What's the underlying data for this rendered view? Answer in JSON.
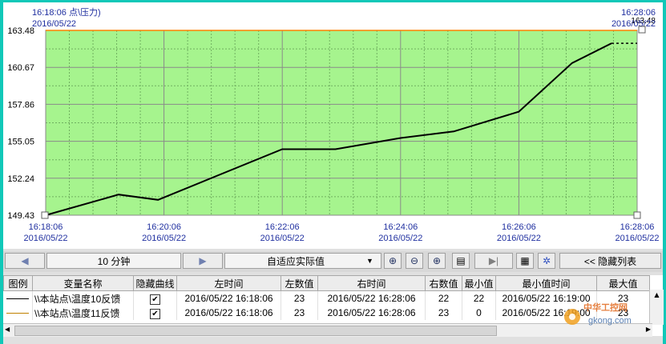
{
  "chart": {
    "top_left_time": "16:18:06",
    "top_left_title": "点\\压力)",
    "top_left_date": "2016/05/22",
    "top_right_time": "16:28:06",
    "top_right_value": "163.48",
    "top_right_date": "2016/05/22",
    "y_ticks": [
      "163.48",
      "160.67",
      "157.86",
      "155.05",
      "152.24",
      "149.43"
    ],
    "x_ticks": [
      {
        "time": "16:18:06",
        "date": "2016/05/22"
      },
      {
        "time": "16:20:06",
        "date": "2016/05/22"
      },
      {
        "time": "16:22:06",
        "date": "2016/05/22"
      },
      {
        "time": "16:24:06",
        "date": "2016/05/22"
      },
      {
        "time": "16:26:06",
        "date": "2016/05/22"
      },
      {
        "time": "16:28:06",
        "date": "2016/05/22"
      }
    ],
    "colors": {
      "plot_bg": "#a6f48e",
      "grid": "#8a8a8a",
      "line": "#000000",
      "top_line": "#ff8000",
      "label_blue": "#2030a0"
    }
  },
  "chart_data": {
    "type": "line",
    "ylim": [
      149.43,
      163.48
    ],
    "xlim": [
      "16:18:06",
      "16:28:06"
    ],
    "grid": true,
    "series": [
      {
        "x": [
          "16:18:06",
          "16:19:20",
          "16:20:00",
          "16:22:06",
          "16:23:00",
          "16:24:06",
          "16:25:00",
          "16:26:06",
          "16:27:00",
          "16:27:40",
          "16:28:06"
        ],
        "values": [
          149.43,
          151.0,
          150.6,
          154.45,
          154.45,
          155.3,
          155.8,
          157.3,
          161.0,
          162.5,
          162.5
        ]
      }
    ]
  },
  "toolbar": {
    "left_arrow": "◀",
    "interval": "10 分钟",
    "right_arrow": "▶",
    "scale_mode": "自适应实际值",
    "dropdown_arrow": "▼",
    "zoom_in": "⊕",
    "zoom_out": "⊖",
    "zoom_fit": "⊕",
    "print": "▤",
    "play": "▶|",
    "copy": "▦",
    "settings": "✲",
    "hide_list": "<< 隐藏列表"
  },
  "table": {
    "headers": [
      "图例",
      "变量名称",
      "隐藏曲线",
      "左时间",
      "左数值",
      "右时间",
      "右数值",
      "最小值",
      "最小值时间",
      "最大值"
    ],
    "rows": [
      {
        "legend_color": "#000000",
        "name": "\\\\本站点\\温度10反馈",
        "hidden": "✔",
        "left_time": "2016/05/22 16:18:06",
        "left_value": "23",
        "right_time": "2016/05/22 16:28:06",
        "right_value": "22",
        "min": "22",
        "min_time": "2016/05/22 16:19:00",
        "max": "23"
      },
      {
        "legend_color": "#c08000",
        "name": "\\\\本站点\\温度11反馈",
        "hidden": "✔",
        "left_time": "2016/05/22 16:18:06",
        "left_value": "23",
        "right_time": "2016/05/22 16:28:06",
        "right_value": "23",
        "min": "0",
        "min_time": "2016/05/22 16:19:00",
        "max": "23"
      }
    ]
  },
  "watermark": {
    "line1": "中华工控网",
    "line2": "gkong.com"
  }
}
